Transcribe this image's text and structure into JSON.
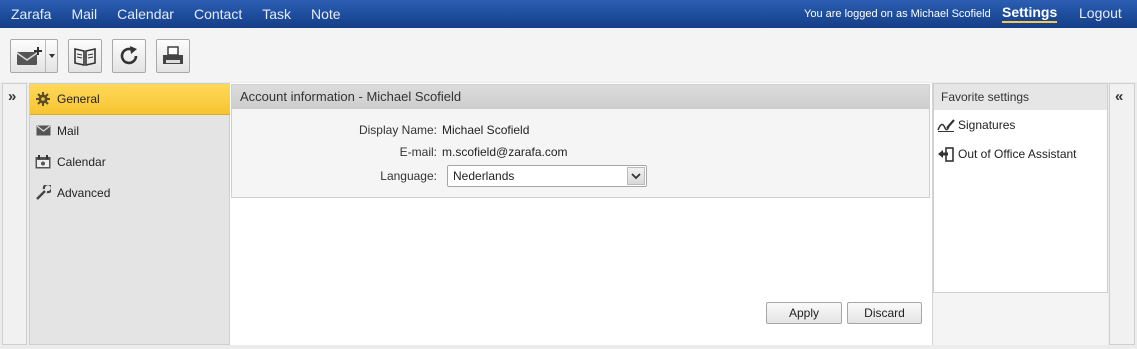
{
  "topnav": {
    "items": [
      "Zarafa",
      "Mail",
      "Calendar",
      "Contact",
      "Task",
      "Note"
    ],
    "logged_on": "You are logged on as Michael Scofield",
    "settings": "Settings",
    "logout": "Logout"
  },
  "toolbar": {
    "buttons": [
      "new-mail",
      "address-book",
      "refresh",
      "print"
    ]
  },
  "sidebar": {
    "items": [
      {
        "label": "General",
        "icon": "gear-icon",
        "active": true
      },
      {
        "label": "Mail",
        "icon": "mail-icon",
        "active": false
      },
      {
        "label": "Calendar",
        "icon": "calendar-icon",
        "active": false
      },
      {
        "label": "Advanced",
        "icon": "wrench-icon",
        "active": false
      }
    ]
  },
  "account": {
    "header": "Account information - Michael Scofield",
    "display_name_label": "Display Name:",
    "display_name": "Michael Scofield",
    "email_label": "E-mail:",
    "email": "m.scofield@zarafa.com",
    "language_label": "Language:",
    "language": "Nederlands"
  },
  "actions": {
    "apply": "Apply",
    "discard": "Discard"
  },
  "favorites": {
    "header": "Favorite settings",
    "items": [
      {
        "label": "Signatures",
        "icon": "signature-icon"
      },
      {
        "label": "Out of Office Assistant",
        "icon": "out-of-office-icon"
      }
    ]
  },
  "colors": {
    "topbar": "#1d4c9c",
    "active_item": "#f6c432",
    "settings_underline": "#f6c94c"
  }
}
